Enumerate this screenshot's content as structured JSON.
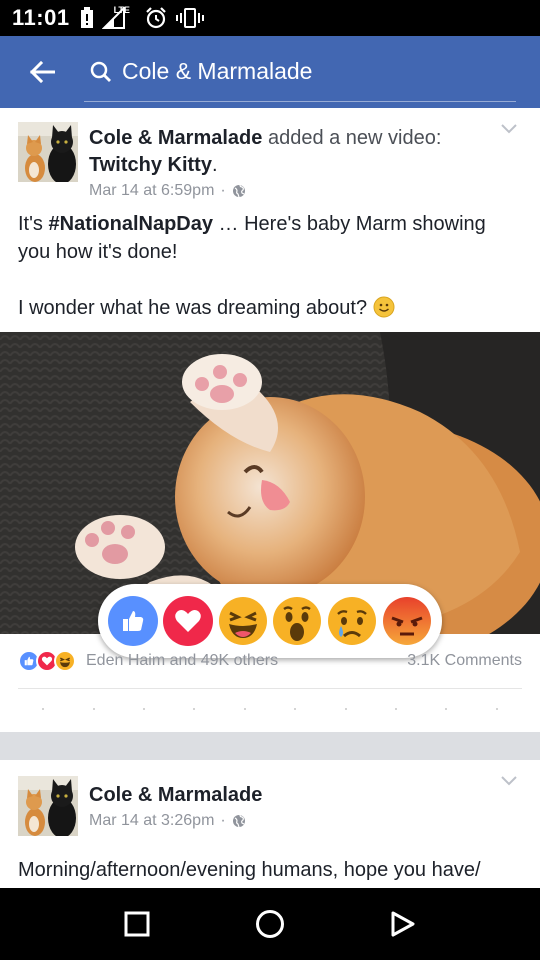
{
  "status_bar": {
    "time": "11:01",
    "network": "LTE"
  },
  "search": {
    "query": "Cole & Marmalade"
  },
  "colors": {
    "brand": "#4267b2",
    "like": "#5890ff",
    "love": "#f0284a",
    "haha": "#f7b125",
    "angry": "#e9710f"
  },
  "post1": {
    "author": "Cole & Marmalade",
    "action": "added a new video:",
    "video_title": "Twitchy Kitty",
    "period": ".",
    "timestamp": "Mar 14 at 6:59pm",
    "separator": "·",
    "body_prefix": "It's ",
    "hashtag": "#NationalNapDay",
    "body_suffix": " … Here's baby Marm showing you how it's done!",
    "body_line2": "I wonder what he was dreaming about?",
    "reactions_names": "Eden Haim and 49K others",
    "comments": "3.1K Comments"
  },
  "reactions": [
    "like",
    "love",
    "haha",
    "wow",
    "sad",
    "angry"
  ],
  "post2": {
    "author": "Cole & Marmalade",
    "timestamp": "Mar 14 at 3:26pm",
    "separator": "·",
    "body": "Morning/afternoon/evening humans, hope you have/"
  }
}
